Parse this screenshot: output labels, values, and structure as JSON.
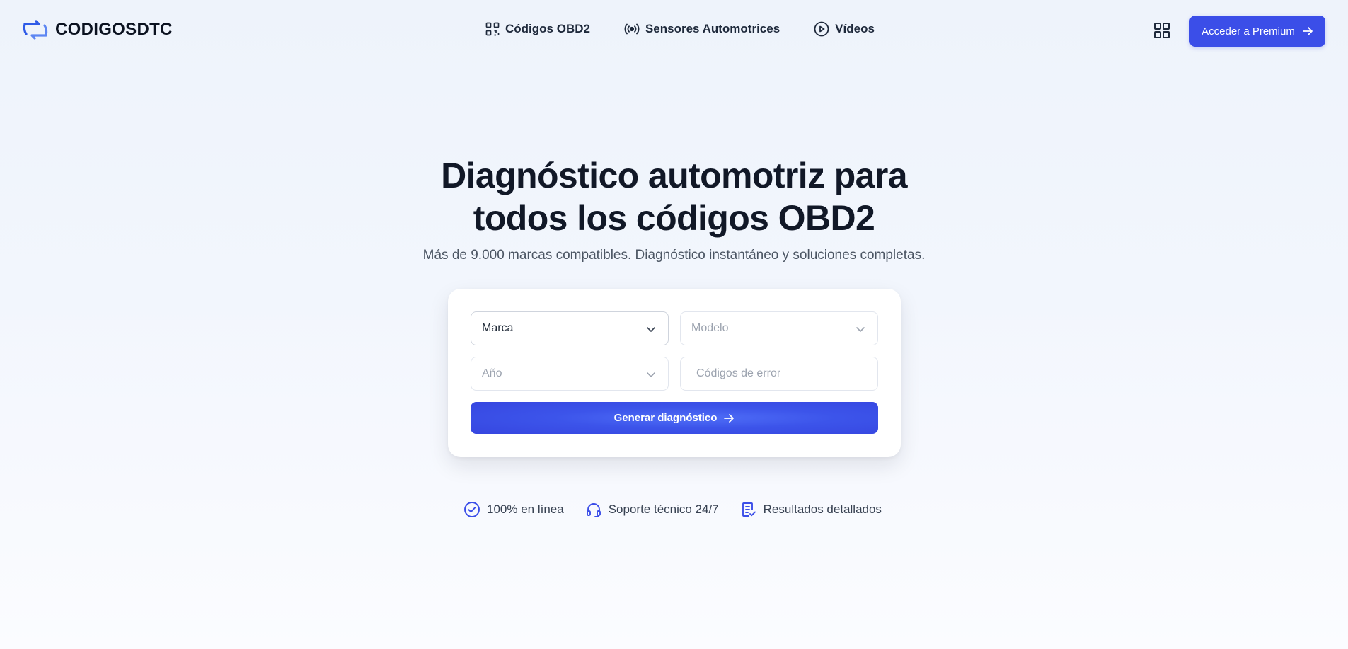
{
  "brand": {
    "name": "CODIGOSDTC"
  },
  "nav": {
    "links": [
      {
        "label": "Códigos OBD2",
        "icon": "qr-code-icon"
      },
      {
        "label": "Sensores Automotrices",
        "icon": "broadcast-icon"
      },
      {
        "label": "Vídeos",
        "icon": "play-circle-icon"
      }
    ],
    "apps_icon": "grid-icon",
    "premium_label": "Acceder a Premium"
  },
  "hero": {
    "title_line1": "Diagnóstico automotriz para",
    "title_line2": "todos los códigos OBD2",
    "subtitle": "Más de 9.000 marcas compatibles. Diagnóstico instantáneo y soluciones completas."
  },
  "form": {
    "marca": "Marca",
    "modelo": "Modelo",
    "anio": "Año",
    "codigos_placeholder": "Códigos de error",
    "submit_label": "Generar diagnóstico"
  },
  "features": [
    {
      "label": "100% en línea",
      "icon": "check-circle-icon"
    },
    {
      "label": "Soporte técnico 24/7",
      "icon": "headset-icon"
    },
    {
      "label": "Resultados detallados",
      "icon": "report-icon"
    }
  ],
  "colors": {
    "accent": "#3b4ee8",
    "text": "#111827",
    "muted": "#4b5563"
  }
}
